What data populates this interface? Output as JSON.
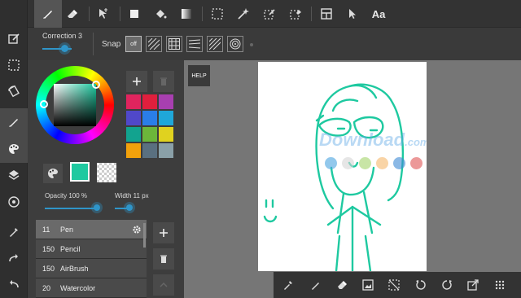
{
  "colors": {
    "accent": "#2f95c9",
    "line_color": "#1ec9a0",
    "canvas_bg": "#767676",
    "paper": "#ffffff"
  },
  "rail": {
    "items": [
      {
        "icon": "edit-canvas-icon"
      },
      {
        "icon": "selection-rect-icon"
      },
      {
        "icon": "rotate-canvas-icon"
      },
      {
        "icon": "brush-tool-icon",
        "active": true
      },
      {
        "icon": "color-palette-icon",
        "active": true
      },
      {
        "icon": "layers-icon"
      },
      {
        "icon": "material-icon"
      },
      {
        "icon": "eyedropper-icon"
      },
      {
        "icon": "redo-icon"
      },
      {
        "icon": "undo-icon"
      }
    ]
  },
  "toolbar": {
    "text_tool_label": "Aa"
  },
  "subbar": {
    "correction_label": "Correction 3",
    "correction_value": 3,
    "snap_label": "Snap",
    "snap_off_label": "off"
  },
  "palette": {
    "swatches": [
      "#e0245e",
      "#e01f3d",
      "#a83fb0",
      "#5048c9",
      "#2a7ee8",
      "#1fa7d9",
      "#12a38f",
      "#6cb63a",
      "#e0d21f",
      "#f2a10c",
      "#5a7080",
      "#8aa0a8"
    ],
    "foreground": "#1ec9a0",
    "background": "#ffffff"
  },
  "sliders": {
    "opacity_label": "Opacity 100 %",
    "opacity_value": 100,
    "width_label": "Width 11 px",
    "width_value": 11
  },
  "brushes": [
    {
      "size": "11",
      "name": "Pen",
      "selected": true
    },
    {
      "size": "150",
      "name": "Pencil"
    },
    {
      "size": "150",
      "name": "AirBrush"
    },
    {
      "size": "20",
      "name": "Watercolor"
    }
  ],
  "canvas": {
    "help_label": "HELP",
    "watermark_text": "Download",
    "watermark_suffix": ".com.vn",
    "watermark_dots": [
      "#4aa3df",
      "#d6d6d6",
      "#a4d36a",
      "#f5b86b",
      "#3c88d4",
      "#e05555"
    ]
  }
}
